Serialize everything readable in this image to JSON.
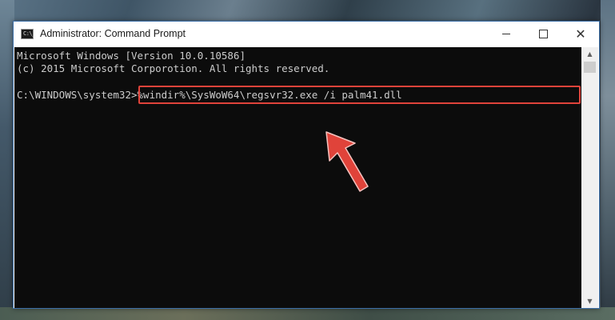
{
  "window": {
    "title": "Administrator: Command Prompt",
    "icon": "cmd-icon",
    "icon_text": "C:\\_"
  },
  "controls": {
    "minimize": "minimize-icon",
    "maximize": "maximize-icon",
    "close": "close-icon",
    "close_glyph": "✕"
  },
  "console": {
    "line1": "Microsoft Windows [Version 10.0.10586]",
    "line2": "(c) 2015 Microsoft Corporotion. All rights reserved.",
    "prompt": "C:\\WINDOWS\\system32>",
    "command": "%windir%\\SysWoW64\\regsvr32.exe /i palm41.dll"
  },
  "scrollbar": {
    "up": "▲",
    "down": "▼"
  },
  "colors": {
    "highlight": "#e0433a",
    "arrow": "#e0433a",
    "console_bg": "#0c0c0c",
    "console_text": "#cccccc"
  }
}
